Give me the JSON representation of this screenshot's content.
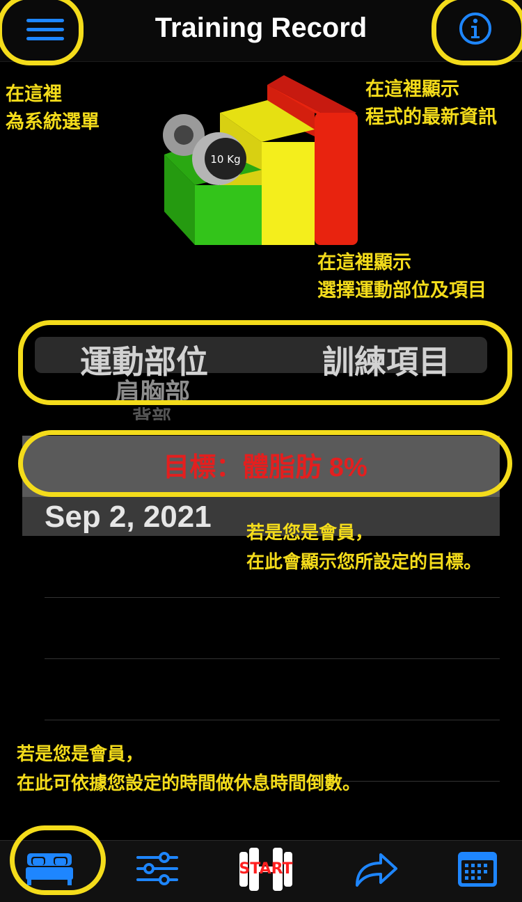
{
  "header": {
    "title": "Training Record",
    "menu_icon": "hamburger-menu-icon",
    "info_icon": "info-circle-icon"
  },
  "logo": {
    "weight_label": "10 Kg"
  },
  "annotations": {
    "menu_note_line1": "在這裡",
    "menu_note_line2": "為系統選單",
    "info_note_line1": "在這裡顯示",
    "info_note_line2": "程式的最新資訊",
    "picker_note_line1": "在這裡顯示",
    "picker_note_line2": "選擇運動部位及項目",
    "goal_note_line1": "若是您是會員，",
    "goal_note_line2": "在此會顯示您所設定的目標。",
    "timer_note_line1": "若是您是會員，",
    "timer_note_line2": "在此可依據您設定的時間做休息時間倒數。"
  },
  "picker": {
    "body_part_label": "運動部位",
    "training_item_label": "訓練項目",
    "next_option": "肩胸部",
    "next_option_2": "背部"
  },
  "goal": {
    "text": "目標：體脂肪 8%"
  },
  "record": {
    "date": "Sep 2, 2021"
  },
  "tabbar": {
    "items": [
      {
        "icon": "bed-icon",
        "selected": true
      },
      {
        "icon": "sliders-icon"
      },
      {
        "icon": "dumbbell-start-icon",
        "label": "START"
      },
      {
        "icon": "share-arrow-icon"
      },
      {
        "icon": "calendar-icon"
      }
    ]
  },
  "colors": {
    "accent_blue": "#1e86ff",
    "highlight_yellow": "#f4dc1b",
    "goal_red": "#e31f1f"
  }
}
